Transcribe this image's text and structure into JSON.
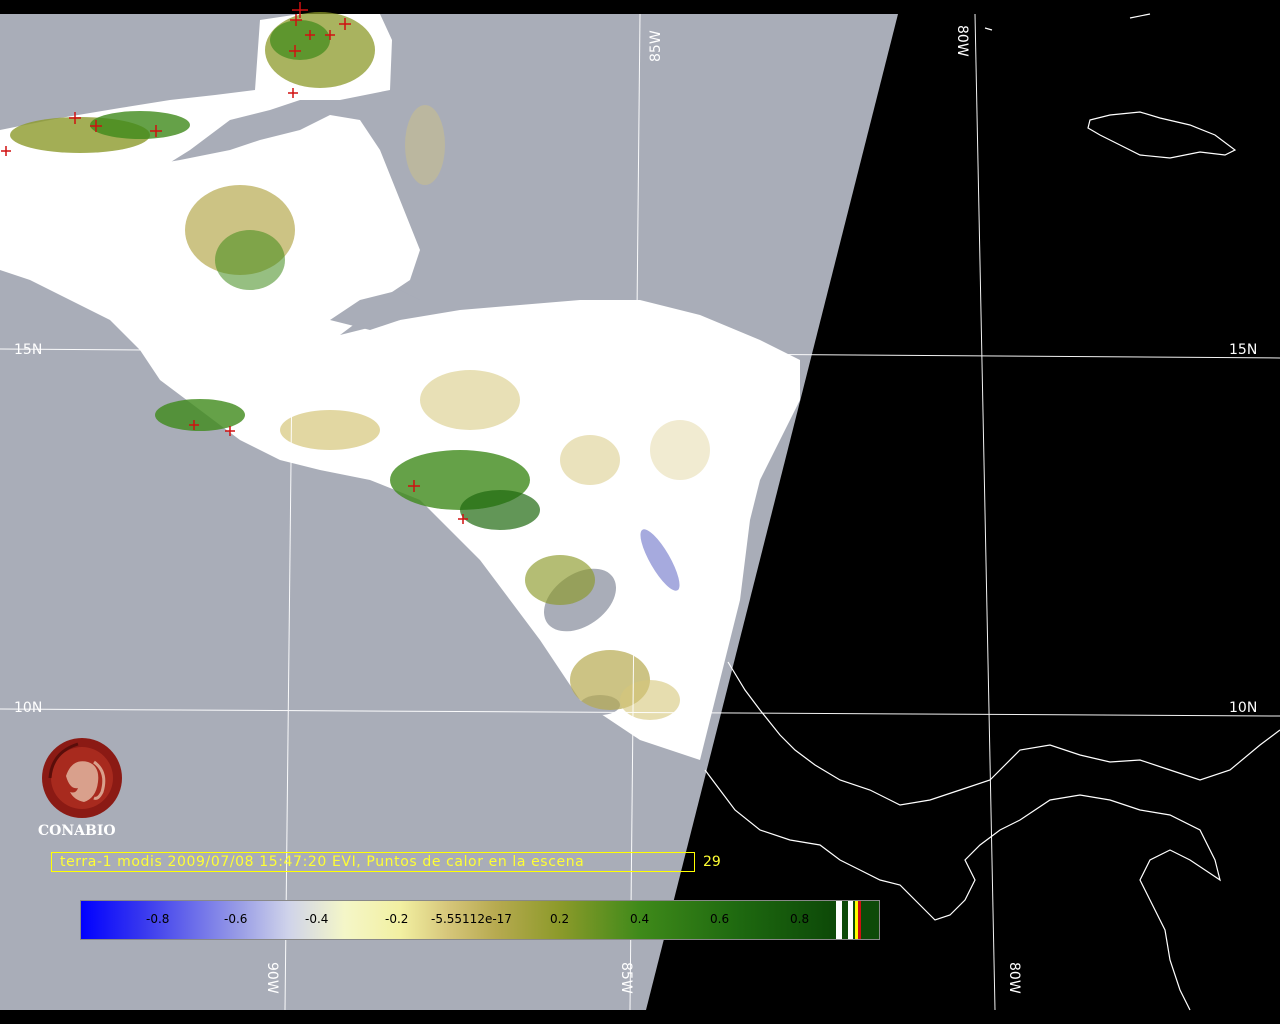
{
  "grid_labels": {
    "lat_15n_left": "15N",
    "lat_15n_right": "15N",
    "lat_10n_left": "10N",
    "lat_10n_right": "10N",
    "lon_85w_top": "85W",
    "lon_80w_top": "80W",
    "lon_90w_bottom": "90W",
    "lon_85w_bottom": "85W",
    "lon_80w_bottom": "80W"
  },
  "caption": "terra-1 modis 2009/07/08 15:47:20 EVI, Puntos de calor en la escena",
  "hotspot_count": "29",
  "logo_text": "CONABIO",
  "colorbar": {
    "ticks": [
      "-0.8",
      "-0.6",
      "-0.4",
      "-0.2",
      "-5.55112e-17",
      "0.2",
      "0.4",
      "0.6",
      "0.8"
    ]
  },
  "colors": {
    "ocean": "#a9adb8",
    "night": "#000000",
    "cloud": "#ffffff",
    "hotspot": "#d01010",
    "caption": "#ffff33",
    "logo": "#8b1a14"
  }
}
